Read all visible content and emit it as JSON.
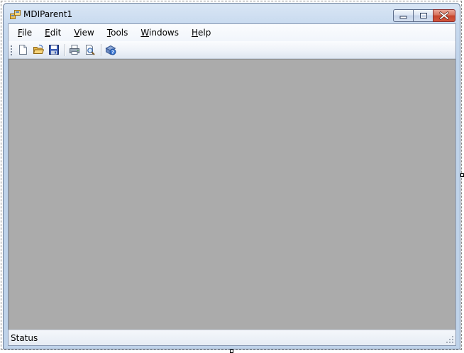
{
  "window": {
    "title": "MDIParent1"
  },
  "menu": {
    "items": [
      {
        "accel": "F",
        "rest": "ile"
      },
      {
        "accel": "E",
        "rest": "dit"
      },
      {
        "accel": "V",
        "rest": "iew"
      },
      {
        "accel": "T",
        "rest": "ools"
      },
      {
        "accel": "W",
        "rest": "indows"
      },
      {
        "accel": "H",
        "rest": "elp"
      }
    ]
  },
  "toolbar": {
    "buttons": [
      "new-file-icon",
      "open-folder-icon",
      "save-icon",
      "print-icon",
      "print-preview-icon",
      "help-icon"
    ]
  },
  "status": {
    "text": "Status"
  },
  "colors": {
    "mdi_background": "#ababab",
    "close_button": "#c5442c"
  }
}
